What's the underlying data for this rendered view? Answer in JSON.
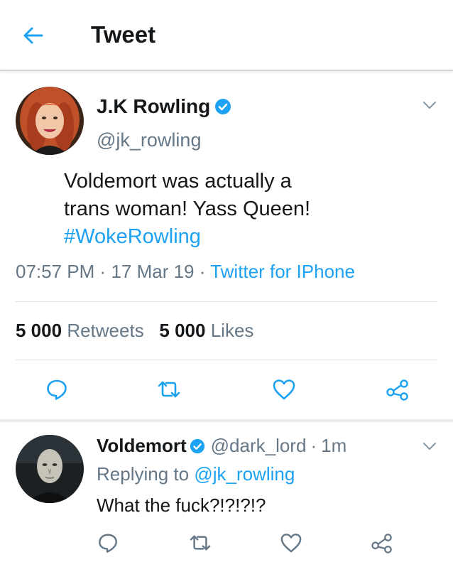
{
  "header": {
    "title": "Tweet"
  },
  "tweet": {
    "author_name": "J.K Rowling",
    "author_handle": "@jk_rowling",
    "text_line1": "Voldemort was actually a",
    "text_line2": "trans woman! Yass Queen!",
    "hashtag": "#WokeRowling",
    "time": "07:57 PM",
    "date": "17 Mar 19",
    "meta_sep": "·",
    "source": "Twitter for IPhone",
    "retweets_count": "5 000",
    "retweets_label": "Retweets",
    "likes_count": "5 000",
    "likes_label": "Likes"
  },
  "reply": {
    "author_name": "Voldemort",
    "author_handle": "@dark_lord",
    "meta_sep": "·",
    "time_ago": "1m",
    "replying_prefix": "Replying to",
    "replying_to": "@jk_rowling",
    "text": "What the fuck?!?!?!?"
  },
  "colors": {
    "accent": "#1da1f2",
    "secondary_text": "#657786",
    "primary_text": "#14171a"
  },
  "icons": {
    "back": "arrow-left-icon",
    "caret": "chevron-down-icon",
    "verified": "verified-badge-icon",
    "reply": "reply-icon",
    "retweet": "retweet-icon",
    "like": "heart-icon",
    "share": "share-icon"
  }
}
